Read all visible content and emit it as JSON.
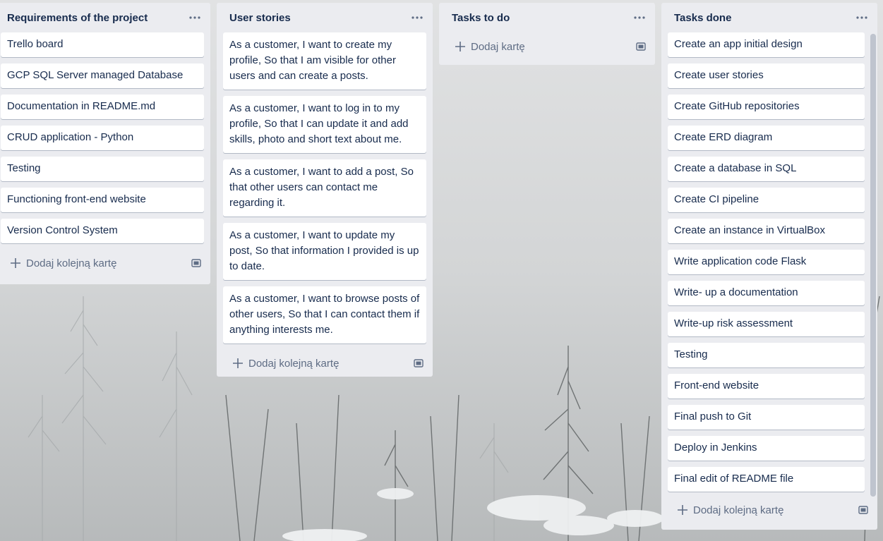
{
  "board": {
    "lists": [
      {
        "title": "Requirements of the project",
        "cards": [
          "Trello board",
          "GCP SQL Server managed Database",
          "Documentation in README.md",
          "CRUD application - Python",
          "Testing",
          "Functioning front-end website",
          "Version Control System"
        ],
        "add_label": "Dodaj kolejną kartę"
      },
      {
        "title": "User stories",
        "cards": [
          "As a customer, I want to create my profile, So that I am visible for other users and can create a posts.",
          "As a customer, I want to log in to my profile, So that I can update it and add skills, photo and short text about me.",
          "As a customer, I want to add a post, So that other users can contact me regarding it.",
          "As a customer, I want to update my post, So that information I provided is up to date.",
          "As a customer, I want to browse posts of other users, So that I can contact them if anything interests me."
        ],
        "add_label": "Dodaj kolejną kartę"
      },
      {
        "title": "Tasks to do",
        "cards": [],
        "add_label": "Dodaj kartę"
      },
      {
        "title": "Tasks done",
        "cards": [
          "Create an app initial design",
          "Create user stories",
          "Create GitHub repositories",
          "Create ERD diagram",
          "Create a database in SQL",
          "Create CI pipeline",
          "Create an instance in VirtualBox",
          "Write application code Flask",
          "Write- up a documentation",
          "Write-up risk assessment",
          "Testing",
          "Front-end website",
          "Final push to Git",
          "Deploy in Jenkins",
          "Final edit of README file"
        ],
        "add_label": "Dodaj kolejną kartę"
      }
    ]
  },
  "icons": {
    "list_menu": "ellipsis-icon",
    "add": "plus-icon",
    "template": "card-template-icon"
  },
  "colors": {
    "list_bg": "#ebecf0",
    "card_bg": "#ffffff",
    "title_text": "#172b4d",
    "muted_text": "#5e6c84"
  }
}
